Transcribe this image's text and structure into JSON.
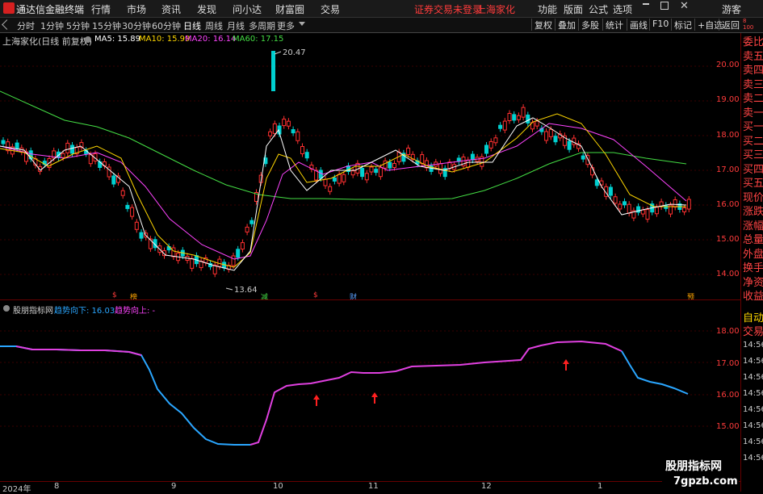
{
  "app": {
    "title": "通达信金融终端"
  },
  "menu": {
    "items": [
      "行情",
      "市场",
      "资讯",
      "发现",
      "问小达",
      "财富圈",
      "交易"
    ],
    "notice": "证券交易未登录",
    "stock": "上海家化",
    "right_items": [
      "功能",
      "版面",
      "公式",
      "选项"
    ],
    "guest": "游客"
  },
  "toolbar": {
    "periods": [
      "分时",
      "1分钟",
      "5分钟",
      "15分钟",
      "30分钟",
      "60分钟",
      "日线",
      "周线",
      "月线",
      "多周期",
      "更多"
    ],
    "active": "日线",
    "buttons": [
      "复权",
      "叠加",
      "多股",
      "统计",
      "画线",
      "F10",
      "标记",
      "+自选",
      "返回"
    ]
  },
  "main_chart": {
    "stock_title": "上海家化(日线 前复权)",
    "ma_labels": [
      {
        "text": "MA5: 15.89",
        "color": "#ffffff"
      },
      {
        "text": "MA10: 15.99",
        "color": "#ffd700"
      },
      {
        "text": "MA20: 16.14",
        "color": "#ff44ff"
      },
      {
        "text": "MA60: 17.15",
        "color": "#44dd44"
      }
    ],
    "y_ticks": [
      "20.00",
      "19.00",
      "18.00",
      "17.00",
      "16.00",
      "15.00",
      "14.00"
    ],
    "high_label": "20.47",
    "low_label": "13.64",
    "badges": [
      {
        "text": "$",
        "color": "#ff3b3b"
      },
      {
        "text": "榜",
        "color": "#ffa500"
      },
      {
        "text": "减",
        "color": "#44dd44"
      },
      {
        "text": "$",
        "color": "#ff3b3b"
      },
      {
        "text": "财",
        "color": "#5aa0ff"
      },
      {
        "text": "预",
        "color": "#ffa500"
      }
    ]
  },
  "indicator": {
    "name": "股朋指标网",
    "down_label": "趋势向下: 16.03",
    "up_label": "趋势向上: -",
    "y_ticks": [
      "18.00",
      "17.00",
      "16.00",
      "15.00"
    ]
  },
  "x_axis": {
    "labels": [
      "2024年",
      "8",
      "9",
      "10",
      "11",
      "12",
      "1"
    ]
  },
  "sidebar": {
    "quote_items": [
      "委比",
      "卖五",
      "卖四",
      "卖三",
      "卖二",
      "卖一",
      "买一",
      "买二",
      "买三",
      "买四",
      "买五",
      "现价",
      "涨跌",
      "涨幅",
      "总量",
      "外盘",
      "换手",
      "净资",
      "收益"
    ],
    "tabs": [
      "自动",
      "交易"
    ],
    "times": [
      "14:56",
      "14:56",
      "14:56",
      "14:56",
      "14:56",
      "14:56",
      "14:56",
      "14:56"
    ],
    "top_values": [
      "8",
      "100"
    ]
  },
  "watermark": {
    "line1": "股朋指标网",
    "line2": "7gpzb.com"
  }
}
